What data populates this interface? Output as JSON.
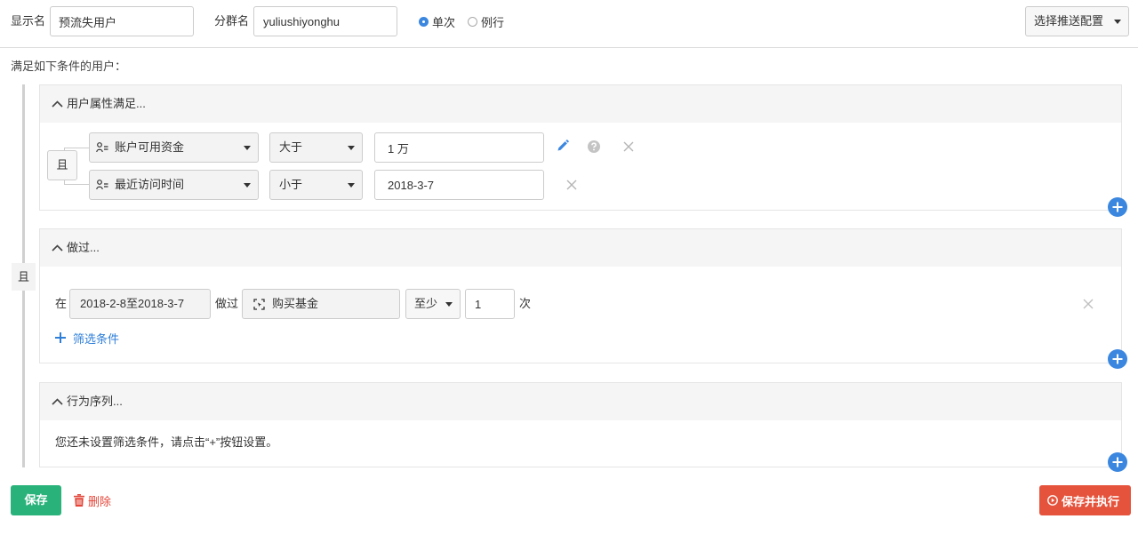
{
  "header": {
    "display_name_label": "显示名",
    "display_name_value": "预流失用户",
    "group_name_label": "分群名",
    "group_name_value": "yuliushiyonghu",
    "mode": {
      "once_label": "单次",
      "once_checked": true,
      "routine_label": "例行",
      "routine_checked": false
    },
    "push_config_label": "选择推送配置"
  },
  "intro_text": "满足如下条件的用户：",
  "outer_logic": "且",
  "sections": {
    "attributes": {
      "title": "用户属性满足...",
      "logic": "且",
      "rows": [
        {
          "property_icon": "user-attribute-icon",
          "property": "账户可用资金",
          "operator": "大于",
          "value": "1 万",
          "actions": [
            "edit-icon",
            "help-icon",
            "close-icon"
          ]
        },
        {
          "property_icon": "user-attribute-icon",
          "property": "最近访问时间",
          "operator": "小于",
          "value": "2018-3-7",
          "actions": [
            "close-icon"
          ]
        }
      ]
    },
    "did": {
      "title": "做过...",
      "prefix": "在",
      "date_range": "2018-2-8至2018-3-7",
      "verb": "做过",
      "event_icon": "event-icon",
      "event": "购买基金",
      "quantifier": "至少",
      "count": "1",
      "unit": "次",
      "add_filter_label": "筛选条件"
    },
    "sequence": {
      "title": "行为序列...",
      "empty_text": "您还未设置筛选条件，请点击“+”按钮设置。"
    }
  },
  "footer": {
    "save_label": "保存",
    "delete_label": "删除",
    "save_execute_label": "保存并执行"
  },
  "colors": {
    "primary_blue": "#3b87e0",
    "save_green": "#2ab27b",
    "execute_red": "#e5533c",
    "delete_red": "#e4473a"
  }
}
